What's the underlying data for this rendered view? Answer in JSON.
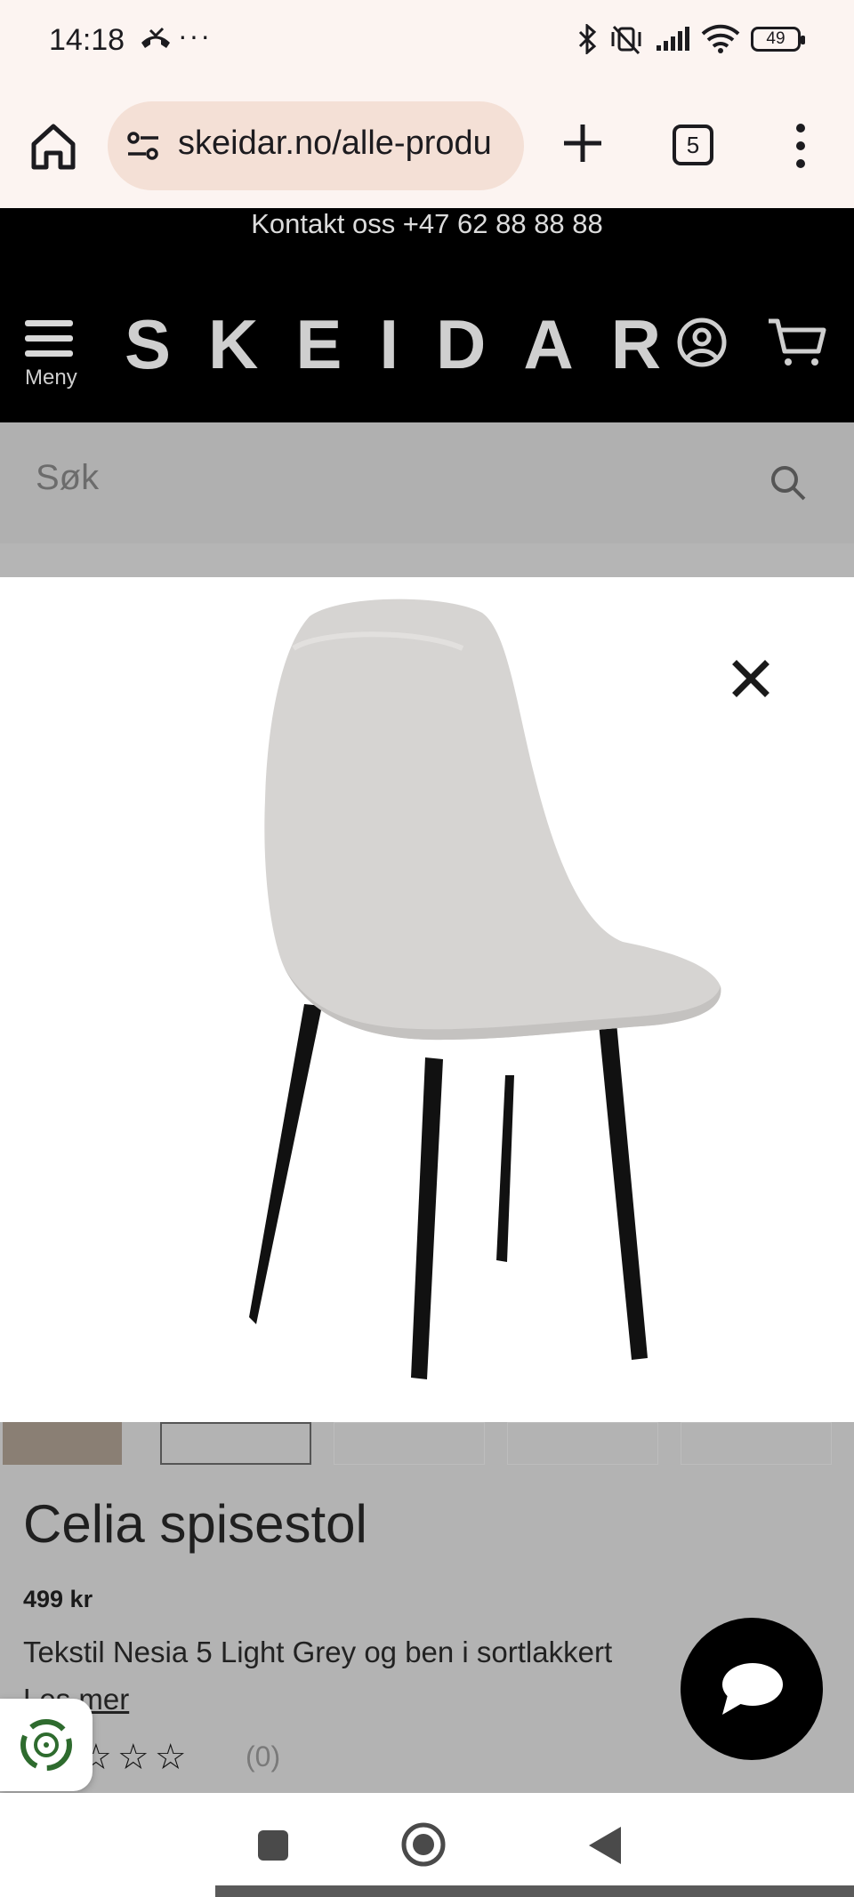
{
  "status_bar": {
    "time": "14:18",
    "more": "···",
    "battery": "49"
  },
  "browser": {
    "url": "skeidar.no/alle-produ",
    "tab_count": "5"
  },
  "site": {
    "contact": "Kontakt oss +47 62 88 88 88",
    "menu_label": "Meny",
    "logo": "SKEIDAR",
    "search_placeholder": "Søk"
  },
  "product": {
    "title": "Celia spisestol",
    "price": "499 kr",
    "description": "Tekstil Nesia 5 Light Grey og ben i sortlakkert",
    "read_more": "Les mer",
    "review_count": "(0)",
    "rating": 0,
    "rating_max": 5
  },
  "colors": {
    "header_bg": "#000000",
    "browser_bg": "#fcf4f1",
    "url_pill": "#f4e0d6",
    "overlay_gray": "#b3b3b3",
    "chair_fabric": "#d6d4d2",
    "chair_legs": "#111111"
  }
}
